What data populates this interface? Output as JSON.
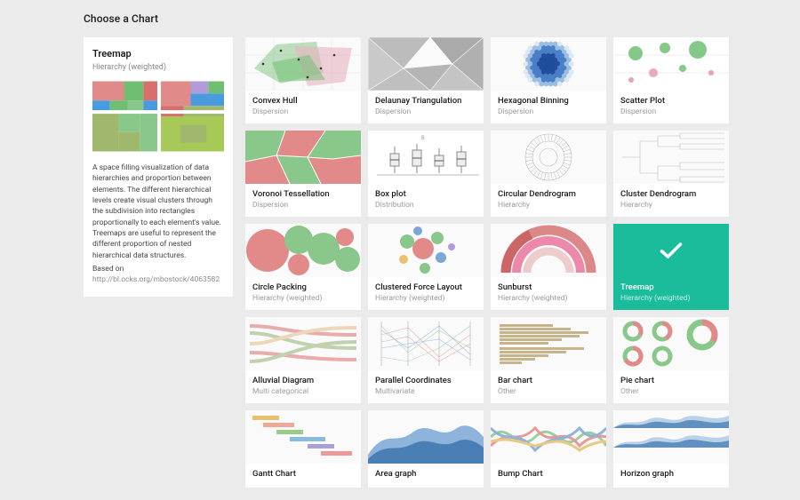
{
  "header": "Choose a Chart",
  "detail": {
    "title": "Treemap",
    "subtitle": "Hierarchy (weighted)",
    "description": "A space filling visualization of data hierarchies and proportion between elements. The different hierarchical levels create visual clusters through the subdivision into rectangles proportionally to each element's value. Treemaps are useful to represent the different proportion of nested hierarchical data structures.",
    "based_label": "Based on",
    "link": "http://bl.ocks.org/mbostock/4063582"
  },
  "cards": [
    {
      "title": "Convex Hull",
      "subtitle": "Dispersion",
      "selected": false,
      "thumb": "convexhull"
    },
    {
      "title": "Delaunay Triangulation",
      "subtitle": "Dispersion",
      "selected": false,
      "thumb": "delaunay"
    },
    {
      "title": "Hexagonal Binning",
      "subtitle": "Dispersion",
      "selected": false,
      "thumb": "hexbin"
    },
    {
      "title": "Scatter Plot",
      "subtitle": "Dispersion",
      "selected": false,
      "thumb": "scatter"
    },
    {
      "title": "Voronoi Tessellation",
      "subtitle": "Dispersion",
      "selected": false,
      "thumb": "voronoi"
    },
    {
      "title": "Box plot",
      "subtitle": "Distribution",
      "selected": false,
      "thumb": "boxplot"
    },
    {
      "title": "Circular Dendrogram",
      "subtitle": "Hierarchy",
      "selected": false,
      "thumb": "circdendro"
    },
    {
      "title": "Cluster Dendrogram",
      "subtitle": "Hierarchy",
      "selected": false,
      "thumb": "clustdendro"
    },
    {
      "title": "Circle Packing",
      "subtitle": "Hierarchy (weighted)",
      "selected": false,
      "thumb": "circlepack"
    },
    {
      "title": "Clustered Force Layout",
      "subtitle": "Hierarchy (weighted)",
      "selected": false,
      "thumb": "force"
    },
    {
      "title": "Sunburst",
      "subtitle": "Hierarchy (weighted)",
      "selected": false,
      "thumb": "sunburst"
    },
    {
      "title": "Treemap",
      "subtitle": "Hierarchy (weighted)",
      "selected": true,
      "thumb": "treemap"
    },
    {
      "title": "Alluvial Diagram",
      "subtitle": "Multi categorical",
      "selected": false,
      "thumb": "alluvial"
    },
    {
      "title": "Parallel Coordinates",
      "subtitle": "Multivariate",
      "selected": false,
      "thumb": "parcoords"
    },
    {
      "title": "Bar chart",
      "subtitle": "Other",
      "selected": false,
      "thumb": "barchart"
    },
    {
      "title": "Pie chart",
      "subtitle": "Other",
      "selected": false,
      "thumb": "piechart"
    },
    {
      "title": "Gantt Chart",
      "subtitle": "",
      "selected": false,
      "thumb": "gantt"
    },
    {
      "title": "Area graph",
      "subtitle": "",
      "selected": false,
      "thumb": "area"
    },
    {
      "title": "Bump Chart",
      "subtitle": "",
      "selected": false,
      "thumb": "bump"
    },
    {
      "title": "Horizon graph",
      "subtitle": "",
      "selected": false,
      "thumb": "horizon"
    }
  ],
  "colors": {
    "green": "#8ac78a",
    "red": "#e08a8a",
    "blue": "#7aa7d6",
    "purple": "#b19cd9",
    "accent": "#1abc9c",
    "grey": "#cfcfcf"
  }
}
